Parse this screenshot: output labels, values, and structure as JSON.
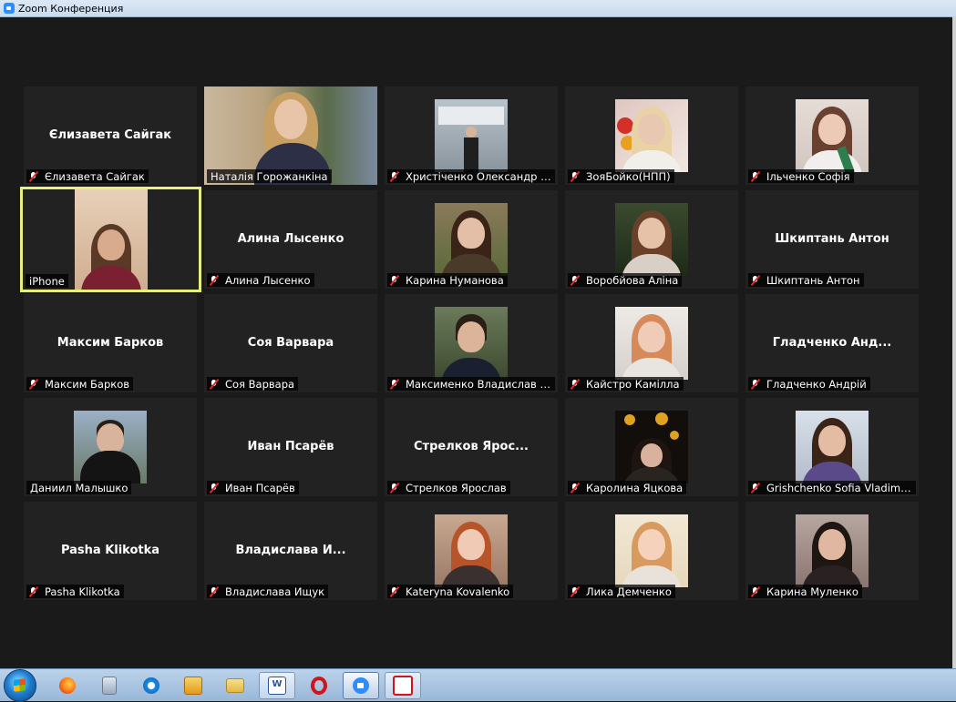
{
  "window": {
    "title": "Zoom Конференция"
  },
  "participants": [
    {
      "display": "Єлизавета Сайгак",
      "label": "Єлизавета Сайгак",
      "muted": true,
      "video": false
    },
    {
      "display": "",
      "label": "Наталія Горожанкіна",
      "muted": false,
      "video": true
    },
    {
      "display": "",
      "label": "Христіченко Олександр М...",
      "muted": true,
      "video": true
    },
    {
      "display": "",
      "label": "ЗояБойко(НПП)",
      "muted": true,
      "video": true
    },
    {
      "display": "",
      "label": "Ільченко Софія",
      "muted": true,
      "video": true
    },
    {
      "display": "",
      "label": "iPhone",
      "muted": false,
      "video": true,
      "active_speaker": true
    },
    {
      "display": "Алина Лысенко",
      "label": "Алина Лысенко",
      "muted": true,
      "video": false
    },
    {
      "display": "",
      "label": "Карина Нуманова",
      "muted": true,
      "video": true
    },
    {
      "display": "",
      "label": "Воробйова Аліна",
      "muted": true,
      "video": true
    },
    {
      "display": "Шкиптань Антон",
      "label": "Шкиптань Антон",
      "muted": true,
      "video": false
    },
    {
      "display": "Максим Барков",
      "label": "Максим Барков",
      "muted": true,
      "video": false
    },
    {
      "display": "Соя Варвара",
      "label": "Соя Варвара",
      "muted": true,
      "video": false
    },
    {
      "display": "",
      "label": "Максименко Владислав М...",
      "muted": true,
      "video": true
    },
    {
      "display": "",
      "label": "Кайстро Камілла",
      "muted": true,
      "video": true
    },
    {
      "display": "Гладченко  Анд...",
      "label": "Гладченко Андрій",
      "muted": true,
      "video": false
    },
    {
      "display": "",
      "label": "Даниил Малышко",
      "muted": false,
      "video": true
    },
    {
      "display": "Иван Псарёв",
      "label": "Иван Псарёв",
      "muted": true,
      "video": false
    },
    {
      "display": "Стрелков  Ярос...",
      "label": "Стрелков Ярослав",
      "muted": true,
      "video": false
    },
    {
      "display": "",
      "label": "Каролина Яцкова",
      "muted": true,
      "video": true
    },
    {
      "display": "",
      "label": "Grishchenko Sofia Vladimir...",
      "muted": true,
      "video": true
    },
    {
      "display": "Pasha Klikotka",
      "label": "Pasha Klikotka",
      "muted": true,
      "video": false
    },
    {
      "display": "Владислава  И...",
      "label": "Владислава Ищук",
      "muted": true,
      "video": false
    },
    {
      "display": "",
      "label": "Kateryna Kovalenko",
      "muted": true,
      "video": true
    },
    {
      "display": "",
      "label": "Лика Демченко",
      "muted": true,
      "video": true
    },
    {
      "display": "",
      "label": "Карина Муленко",
      "muted": true,
      "video": true
    }
  ],
  "taskbar": {
    "apps": [
      {
        "icon": "firefox-icon"
      },
      {
        "icon": "calculator-icon"
      },
      {
        "icon": "internet-explorer-icon"
      },
      {
        "icon": "media-player-icon"
      },
      {
        "icon": "file-explorer-icon"
      },
      {
        "icon": "word-icon",
        "glyph": "W"
      },
      {
        "icon": "opera-icon"
      },
      {
        "icon": "zoom-icon"
      },
      {
        "icon": "screen-capture-icon"
      }
    ]
  },
  "colors": {
    "active_speaker_border": "#e6f07a",
    "mute_slash": "#e02b2b",
    "tile_background": "#222222",
    "window_background": "#1a1a1a"
  }
}
